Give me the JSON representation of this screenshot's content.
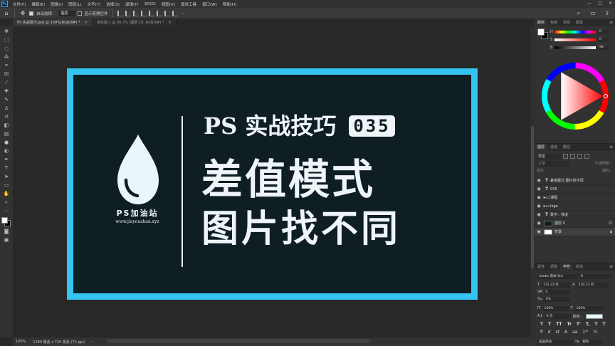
{
  "menubar": {
    "logo": "Ps",
    "items": [
      "文件(F)",
      "编辑(E)",
      "图像(I)",
      "图层(L)",
      "文字(Y)",
      "选择(S)",
      "滤镜(T)",
      "3D(D)",
      "视图(V)",
      "增效工具",
      "窗口(W)",
      "帮助(H)"
    ],
    "controls": [
      "—",
      "□",
      "✕"
    ]
  },
  "options": {
    "auto_select_label": "自动选择：",
    "auto_select_value": "图层",
    "show_transform_label": "显示变换控件",
    "more": "···"
  },
  "tabs": [
    {
      "label": "PS 实战技巧.psd @ 100%(RGB/8#) *",
      "close": "×"
    },
    {
      "label": "未标题-1 @ 66.7% (图层 10, RGB/8#) *",
      "close": "×"
    }
  ],
  "canvas": {
    "brand": "PS加油站",
    "url": "www.jiayouzhan.xyz",
    "title": "PS 实战技巧",
    "badge": "035",
    "line1": "差值模式",
    "line2": "图片找不同"
  },
  "status": {
    "zoom": "100%",
    "doc_info": "1280 像素 x 720 像素 (72 ppi)",
    "arrow": "›"
  },
  "color_panel": {
    "tabs": [
      "颜色",
      "色板",
      "渐变",
      "图案"
    ],
    "sliders": [
      {
        "label": "H",
        "value": "0"
      },
      {
        "label": "S",
        "value": "0"
      },
      {
        "label": "B",
        "value": "98"
      }
    ]
  },
  "layers_panel": {
    "tabs": [
      "图层",
      "通道",
      "路径"
    ],
    "filter": "类型",
    "blend": "正常",
    "opacity_label": "不透明度：",
    "lock_label": "锁定：",
    "fill_label": "填充：",
    "layers": [
      {
        "kind": "T",
        "name": "差值模式 图片找不同"
      },
      {
        "kind": "T",
        "name": "035"
      },
      {
        "kind": "folder",
        "name": "课程"
      },
      {
        "kind": "folder",
        "name": "logo"
      },
      {
        "kind": "T",
        "name": "数字：铁凌"
      },
      {
        "kind": "thumb",
        "name": "图层 0"
      },
      {
        "kind": "thumb",
        "name": "背景"
      }
    ]
  },
  "char_panel": {
    "tabs": [
      "属性",
      "调整",
      "字符",
      "段落"
    ],
    "font": "Adobe 黑体 Std",
    "style": "R",
    "size": "171.23 点",
    "leading": "216.73 点",
    "kerning": "0",
    "tracking": "0%",
    "vscale": "100%",
    "hscale": "100%",
    "baseline": "0 点",
    "color_label": "颜色：",
    "formats": [
      "T",
      "T",
      "TT",
      "Tr",
      "T'",
      "T,",
      "T",
      "T"
    ],
    "lang": "美国英语",
    "aa": "锐利"
  }
}
